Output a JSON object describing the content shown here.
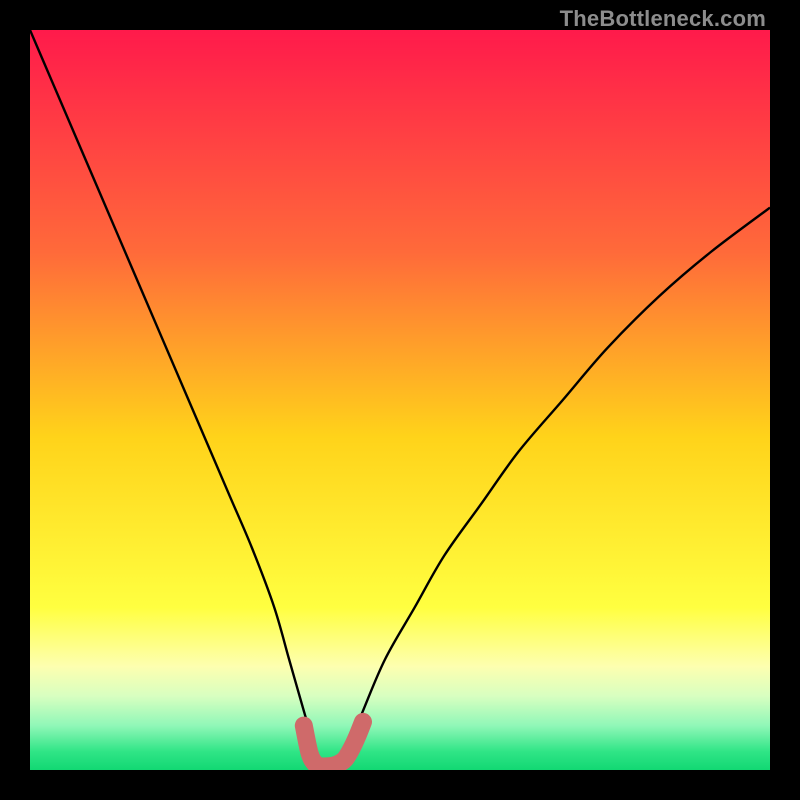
{
  "watermark": "TheBottleneck.com",
  "chart_data": {
    "type": "line",
    "title": "",
    "xlabel": "",
    "ylabel": "",
    "xlim": [
      0,
      100
    ],
    "ylim": [
      0,
      100
    ],
    "grid": false,
    "series": [
      {
        "name": "bottleneck-curve",
        "x": [
          0,
          3,
          6,
          9,
          12,
          15,
          18,
          21,
          24,
          27,
          30,
          33,
          35,
          37,
          38.5,
          40,
          41.5,
          43,
          45,
          48,
          52,
          56,
          61,
          66,
          72,
          78,
          85,
          92,
          100
        ],
        "y": [
          100,
          93,
          86,
          79,
          72,
          65,
          58,
          51,
          44,
          37,
          30,
          22,
          15,
          8,
          3,
          0.5,
          0.5,
          3,
          8,
          15,
          22,
          29,
          36,
          43,
          50,
          57,
          64,
          70,
          76
        ]
      }
    ],
    "marker_band": {
      "name": "optimal-range",
      "x": [
        37.0,
        37.8,
        38.6,
        39.4,
        40.2,
        41.0,
        41.8,
        42.6,
        43.4,
        44.2,
        45.0
      ],
      "y": [
        6.0,
        2.2,
        0.8,
        0.5,
        0.5,
        0.6,
        0.9,
        1.5,
        2.8,
        4.5,
        6.5
      ]
    },
    "gradient_stops": [
      {
        "offset": 0.0,
        "color": "#ff1a4b"
      },
      {
        "offset": 0.3,
        "color": "#ff6a3a"
      },
      {
        "offset": 0.55,
        "color": "#ffd31a"
      },
      {
        "offset": 0.78,
        "color": "#ffff40"
      },
      {
        "offset": 0.86,
        "color": "#fdffb0"
      },
      {
        "offset": 0.9,
        "color": "#d8ffc0"
      },
      {
        "offset": 0.94,
        "color": "#90f7b8"
      },
      {
        "offset": 0.975,
        "color": "#30e586"
      },
      {
        "offset": 1.0,
        "color": "#12d873"
      }
    ],
    "colors": {
      "curve": "#000000",
      "marker": "#cf6a6a",
      "background_frame": "#000000"
    }
  }
}
